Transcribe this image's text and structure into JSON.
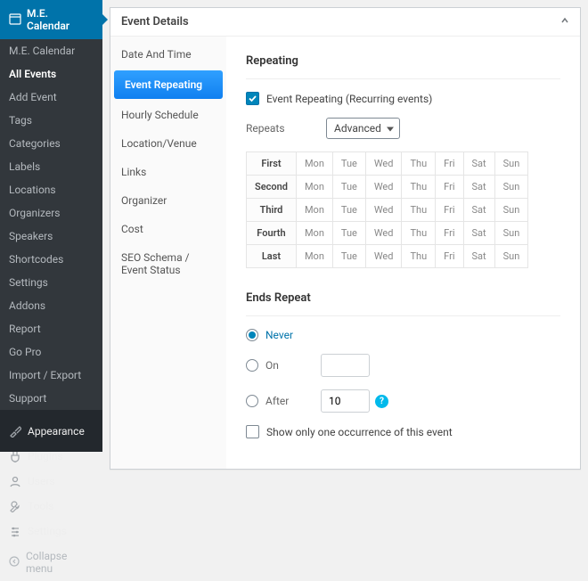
{
  "brand": "M.E. Calendar",
  "sub_items": [
    "M.E. Calendar",
    "All Events",
    "Add Event",
    "Tags",
    "Categories",
    "Labels",
    "Locations",
    "Organizers",
    "Speakers",
    "Shortcodes",
    "Settings",
    "Addons",
    "Report",
    "Go Pro",
    "Import / Export",
    "Support"
  ],
  "sub_current": 1,
  "main_items": [
    {
      "label": "Appearance",
      "icon": "brush"
    },
    {
      "label": "Plugins",
      "icon": "plug"
    },
    {
      "label": "Users",
      "icon": "user"
    },
    {
      "label": "Tools",
      "icon": "wrench"
    },
    {
      "label": "Settings",
      "icon": "sliders"
    }
  ],
  "collapse_label": "Collapse menu",
  "metabox_title": "Event Details",
  "tabs": [
    "Date And Time",
    "Event Repeating",
    "Hourly Schedule",
    "Location/Venue",
    "Links",
    "Organizer",
    "Cost",
    "SEO Schema / Event Status"
  ],
  "active_tab": 1,
  "repeating": {
    "heading": "Repeating",
    "checkbox_label": "Event Repeating (Recurring events)",
    "checkbox_checked": true,
    "repeats_label": "Repeats",
    "repeats_value": "Advanced",
    "rows": [
      "First",
      "Second",
      "Third",
      "Fourth",
      "Last"
    ],
    "days": [
      "Mon",
      "Tue",
      "Wed",
      "Thu",
      "Fri",
      "Sat",
      "Sun"
    ]
  },
  "ends": {
    "heading": "Ends Repeat",
    "options": [
      "Never",
      "On",
      "After"
    ],
    "selected": 0,
    "on_value": "",
    "after_value": "10",
    "show_one_label": "Show only one occurrence of this event",
    "show_one_checked": false
  }
}
